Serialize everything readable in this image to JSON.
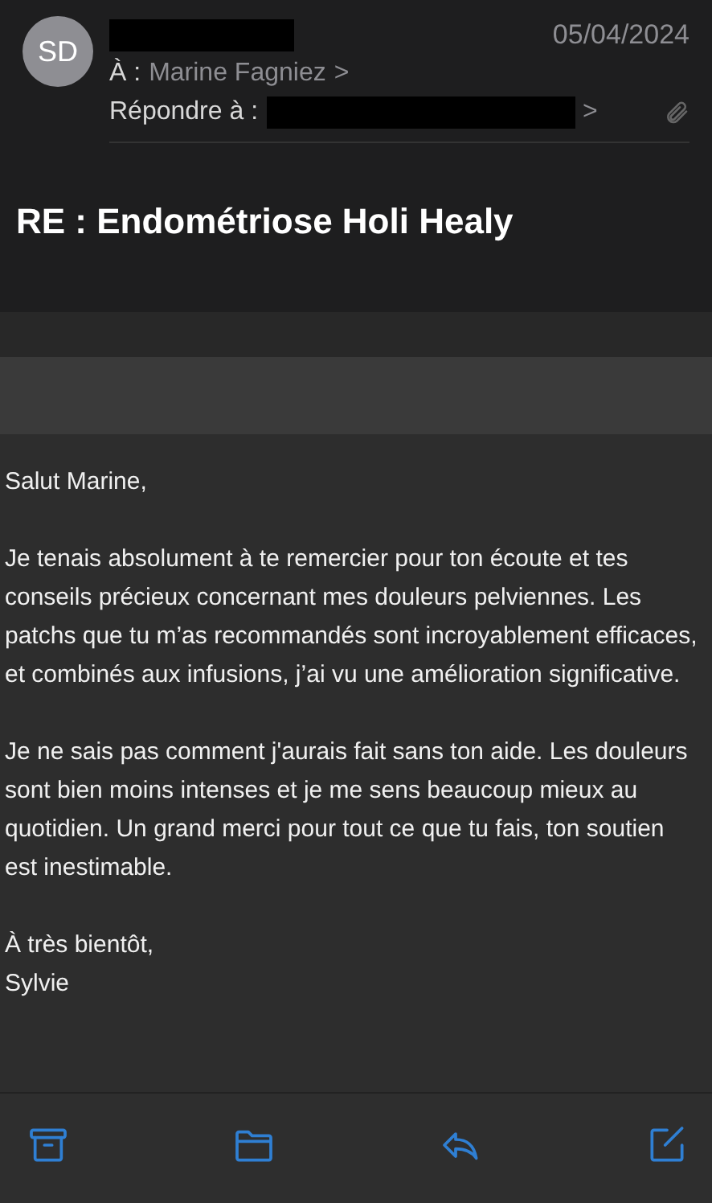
{
  "header": {
    "avatar_initials": "SD",
    "date": "05/04/2024",
    "to_label": "À :",
    "to_name": "Marine Fagniez",
    "to_chevron": ">",
    "reply_label": "Répondre à :",
    "reply_chevron": ">"
  },
  "subject": "RE : Endométriose Holi Healy",
  "body": [
    "Salut Marine,",
    "Je tenais absolument à te remercier pour ton écoute et tes conseils précieux concernant mes douleurs pelviennes. Les patchs que tu m’as recommandés sont incroyablement efficaces, et combinés aux infusions, j’ai vu une amélioration significative.",
    "Je ne sais pas comment j'aurais fait sans ton aide. Les douleurs sont bien moins intenses et je me sens beaucoup mieux au quotidien. Un grand merci pour tout ce que tu fais, ton soutien est inestimable.",
    "À très bientôt,\nSylvie"
  ]
}
